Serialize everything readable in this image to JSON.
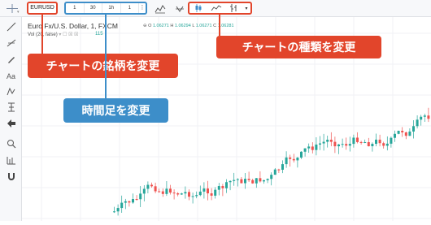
{
  "toolbar": {
    "symbol": "EURUSD",
    "intervals": [
      "1",
      "30",
      "1h",
      "1",
      "⋮"
    ],
    "chart_type_dropdown": "▾"
  },
  "legend": {
    "title": "Euro Fx/U.S. Dollar, 1, FXCM",
    "ohlc": {
      "o_label": "O",
      "o_value": "1.06271",
      "h_label": "H",
      "h_value": "1.06294",
      "l_label": "L",
      "l_value": "1.06271",
      "c_label": "C",
      "c_value": "1.06281"
    },
    "volume_label": "Vol (20, false)",
    "volume_value": "115"
  },
  "callouts": {
    "symbol": "チャートの銘柄を変更",
    "interval": "時間足を変更",
    "chart_type": "チャートの種類を変更"
  },
  "colors": {
    "accent_red": "#e2452b",
    "accent_blue": "#3d8ec9",
    "candle_up": "#26a69a",
    "candle_down": "#ef5350"
  }
}
